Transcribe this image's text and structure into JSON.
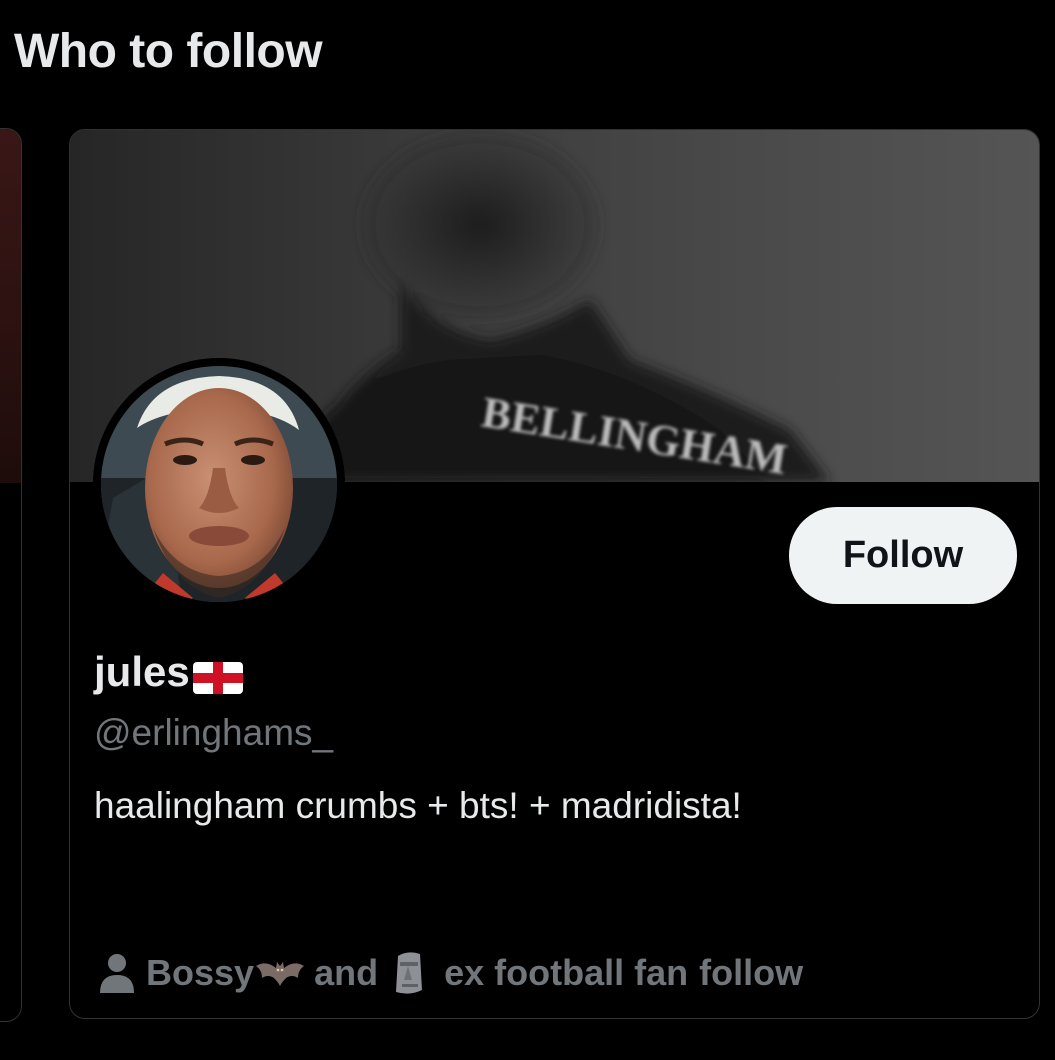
{
  "section": {
    "title": "Who to follow"
  },
  "card": {
    "banner_text": "BELLINGHAM",
    "display_name": "jules",
    "display_name_flag": "england-flag-icon",
    "handle": "@erlinghams_",
    "bio": "haalingham crumbs + bts! + madridista!",
    "follow_label": "Follow",
    "followed_by": {
      "icon": "person-icon",
      "first_name": "Bossy",
      "first_name_emoji": "bat-icon",
      "joiner": "and",
      "second_name_emoji": "moai-icon",
      "second_name": "ex football fan",
      "suffix": "follow"
    }
  },
  "colors": {
    "background": "#000000",
    "card_border": "#2f3336",
    "primary_text": "#e7e9ea",
    "secondary_text": "#71767b",
    "follow_button_bg": "#eff3f4",
    "follow_button_text": "#0f1419"
  }
}
